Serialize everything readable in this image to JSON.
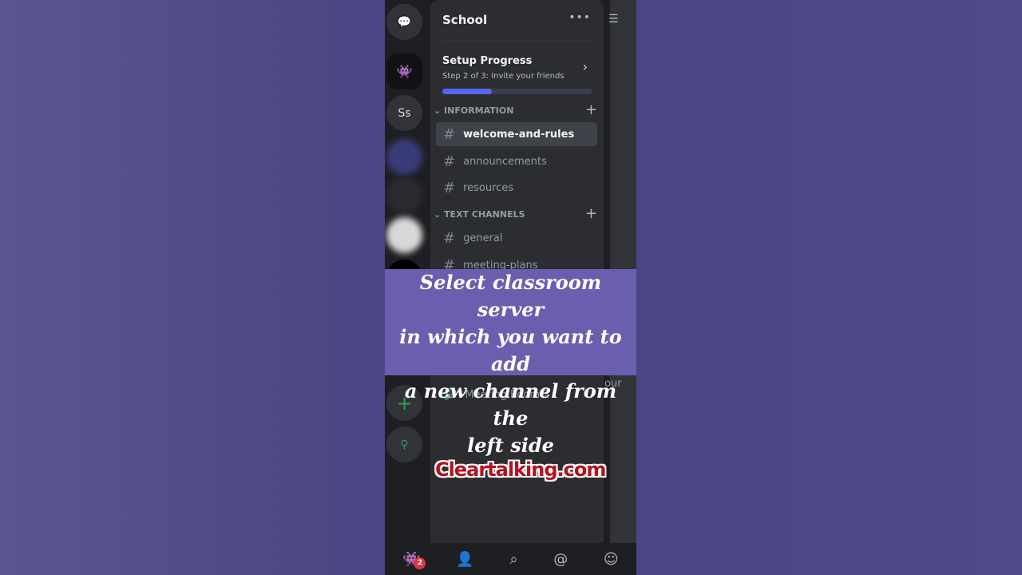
{
  "server": {
    "name": "School",
    "menu_icon": "more-icon"
  },
  "setup": {
    "title": "Setup Progress",
    "subtitle": "Step 2 of 3: Invite your friends",
    "progress_fraction": 0.33
  },
  "categories": [
    {
      "label": "INFORMATION",
      "channels": [
        "welcome-and-rules",
        "announcements",
        "resources"
      ]
    },
    {
      "label": "TEXT CHANNELS",
      "channels": [
        "general",
        "meeting-plans"
      ]
    }
  ],
  "voice_channel": "Meeting Room 2",
  "rail": {
    "dm_abbrev": "Ss"
  },
  "right_peek": "our",
  "overlay": {
    "line1": "Select classroom server",
    "line2": "in which you want to add",
    "line3": "a new channel from the",
    "line4": "left side"
  },
  "watermark": "Cleartalking.com",
  "nav": {
    "badge": "2"
  },
  "colors": {
    "accent": "#5865f2",
    "overlay": "#6a5fae",
    "watermark": "#b3121f"
  }
}
